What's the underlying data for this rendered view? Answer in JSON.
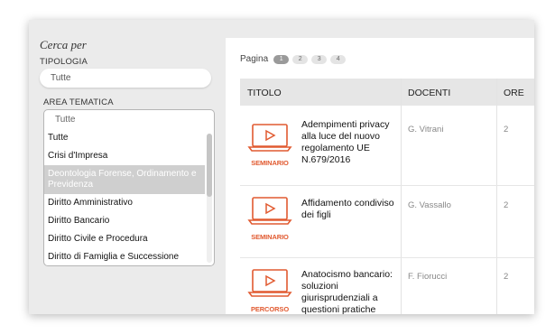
{
  "filters": {
    "title": "Cerca per",
    "tipologia_label": "TIPOLOGIA",
    "tipologia_value": "Tutte",
    "area_label": "AREA TEMATICA",
    "area_value": "Tutte",
    "options": [
      "Tutte",
      "Crisi d'Impresa",
      "Deontologia Forense, Ordinamento e Previdenza",
      "Diritto Amministrativo",
      "Diritto Bancario",
      "Diritto Civile e Procedura",
      "Diritto di Famiglia e Successione"
    ],
    "selected_option": "Deontologia Forense, Ordinamento e Previdenza"
  },
  "pagination": {
    "label": "Pagina",
    "pages": [
      "1",
      "2",
      "3",
      "4"
    ],
    "current": "1"
  },
  "table": {
    "headers": {
      "title": "TITOLO",
      "teachers": "DOCENTI",
      "hours": "ORE"
    },
    "rows": [
      {
        "tag": "SEMINARIO",
        "title": "Adempimenti privacy alla luce del nuovo regolamento UE N.679/2016",
        "teacher": "G. Vitrani",
        "hours": "2"
      },
      {
        "tag": "SEMINARIO",
        "title": "Affidamento condiviso dei figli",
        "teacher": "G. Vassallo",
        "hours": "2"
      },
      {
        "tag": "PERCORSO",
        "title": "Anatocismo bancario: soluzioni giurisprudenziali a questioni pratiche",
        "teacher": "F. Fiorucci",
        "hours": "2"
      }
    ]
  },
  "colors": {
    "accent": "#e15a30",
    "selected_bg": "#cfcfcf"
  },
  "icons": {
    "course": "laptop-play-icon"
  }
}
